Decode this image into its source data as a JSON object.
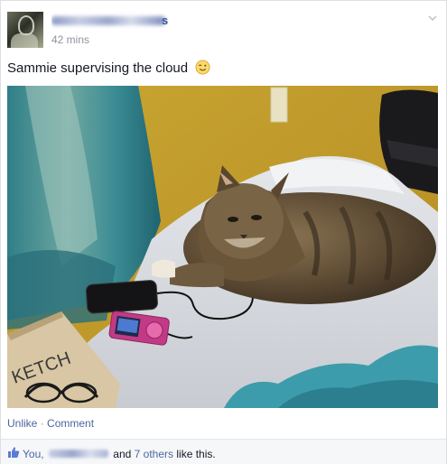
{
  "post": {
    "author_suffix": "s",
    "timestamp": "42 mins",
    "message": "Sammie supervising the cloud",
    "message_emoji": "wink-emoji",
    "menu_icon": "chevron-down-icon"
  },
  "actions": {
    "unlike": "Unlike",
    "separator": "·",
    "comment": "Comment"
  },
  "likes": {
    "icon": "thumbs-up-icon",
    "prefix": "You,",
    "connector": "and",
    "others": "7 others",
    "suffix": "like this."
  },
  "colors": {
    "link": "#4b67a1",
    "muted": "#90949c",
    "likes_bar": "#f6f7f9"
  }
}
